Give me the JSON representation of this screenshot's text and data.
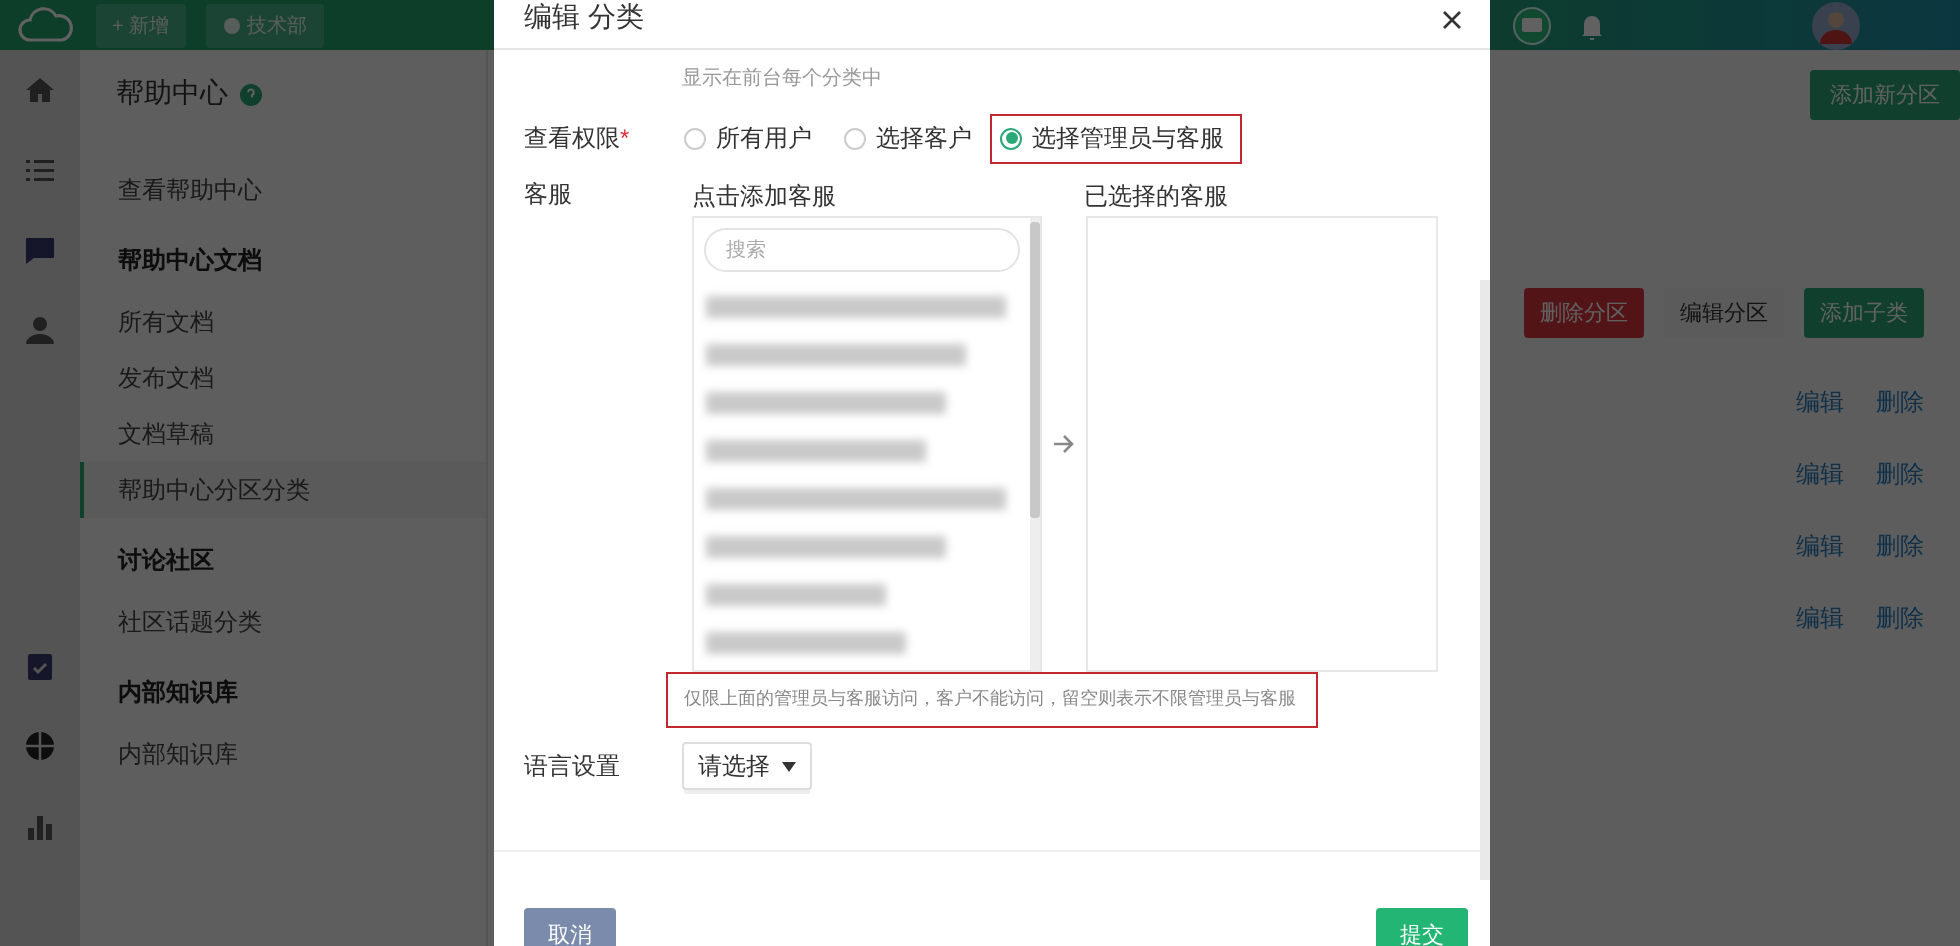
{
  "top_bar": {
    "tabs": [
      {
        "label": "+ 新增"
      },
      {
        "label": "技术部"
      }
    ]
  },
  "sidebar": {
    "title": "帮助中心",
    "items": [
      {
        "label": "查看帮助中心",
        "kind": "link",
        "selected": false
      },
      {
        "label": "帮助中心文档",
        "kind": "header",
        "selected": false
      },
      {
        "label": "所有文档",
        "kind": "link",
        "selected": false
      },
      {
        "label": "发布文档",
        "kind": "link",
        "selected": false
      },
      {
        "label": "文档草稿",
        "kind": "link",
        "selected": false
      },
      {
        "label": "帮助中心分区分类",
        "kind": "link",
        "selected": true
      },
      {
        "label": "讨论社区",
        "kind": "header",
        "selected": false
      },
      {
        "label": "社区话题分类",
        "kind": "link",
        "selected": false
      },
      {
        "label": "内部知识库",
        "kind": "header",
        "selected": false
      },
      {
        "label": "内部知识库",
        "kind": "link",
        "selected": false
      }
    ]
  },
  "main": {
    "add_button": "添加新分区",
    "section_buttons": [
      {
        "label": "删除分区",
        "kind": "danger"
      },
      {
        "label": "编辑分区",
        "kind": "default"
      },
      {
        "label": "添加子类",
        "kind": "primary"
      }
    ],
    "rows": [
      {
        "edit": "编辑",
        "delete": "删除"
      },
      {
        "edit": "编辑",
        "delete": "删除"
      },
      {
        "edit": "编辑",
        "delete": "删除"
      },
      {
        "edit": "编辑",
        "delete": "删除"
      }
    ]
  },
  "dialog": {
    "title": "编辑 分类",
    "hint": "显示在前台每个分类中",
    "permission": {
      "label": "查看权限",
      "required_mark": "*",
      "options": [
        {
          "label": "所有用户",
          "selected": false,
          "annotated": false
        },
        {
          "label": "选择客户",
          "selected": false,
          "annotated": false
        },
        {
          "label": "选择管理员与客服",
          "selected": true,
          "annotated": true
        }
      ]
    },
    "service": {
      "label": "客服",
      "available_title": "点击添加客服",
      "search_placeholder": "搜索",
      "selected_title": "已选择的客服"
    },
    "note": {
      "text": "仅限上面的管理员与客服访问，客户不能访问，留空则表示不限管理员与客服",
      "annotated": true
    },
    "language": {
      "label": "语言设置",
      "value": "请选择"
    },
    "buttons": [
      {
        "label": "取消",
        "kind": "cancel"
      },
      {
        "label": "提交",
        "kind": "submit"
      }
    ]
  }
}
